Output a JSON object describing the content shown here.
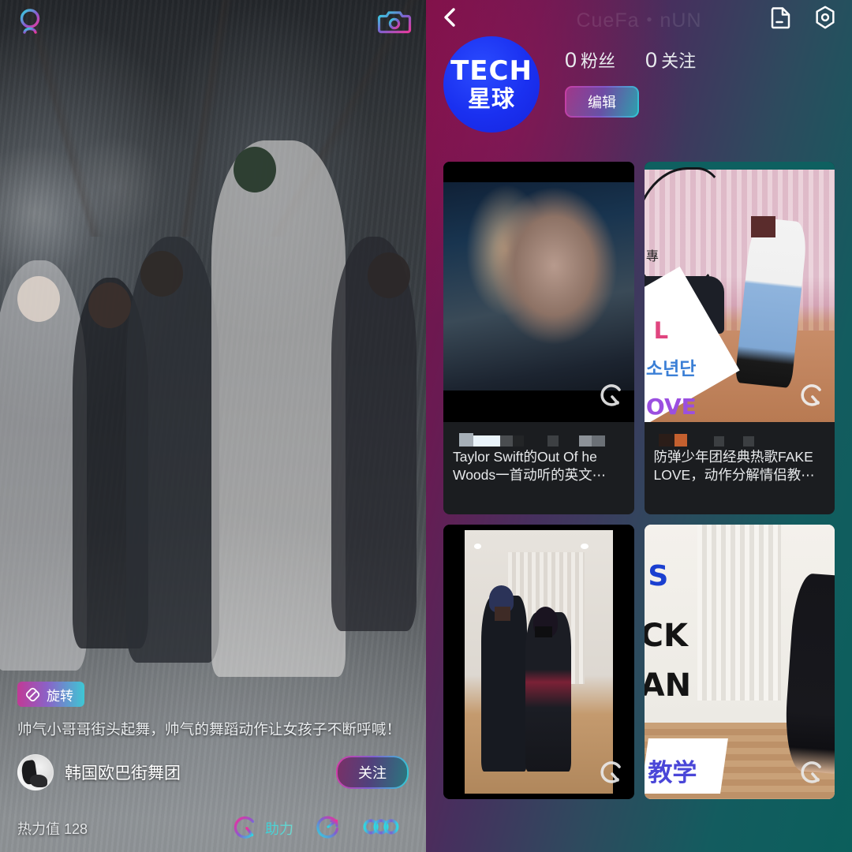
{
  "left_panel": {
    "topbar": {
      "logo_icon": "q-brand-icon",
      "camera_icon": "camera-icon"
    },
    "rotate_chip": {
      "icon": "rotate-icon",
      "label": "旋转"
    },
    "caption": "帅气小哥哥街头起舞，帅气的舞蹈动作让女孩子不断呼喊！",
    "user": {
      "name": "韩国欧巴街舞团",
      "avatar_icon": "user-avatar",
      "follow_label": "关注"
    },
    "heat_label": "热力值",
    "heat_value": "128",
    "actions": [
      {
        "icon": "boost-q-icon",
        "label": "助力"
      },
      {
        "icon": "share-arrow-icon",
        "label": ""
      },
      {
        "icon": "triple-circle-icon",
        "label": ""
      }
    ]
  },
  "right_panel": {
    "topbar": {
      "back_icon": "chevron-left-icon",
      "watermark_title": "CueFa・nUN",
      "file_icon": "file-minus-icon",
      "settings_icon": "hex-gear-icon"
    },
    "profile": {
      "avatar_line1": "TECH",
      "avatar_line2": "星球",
      "stats": [
        {
          "value": "0",
          "label": "粉丝"
        },
        {
          "value": "0",
          "label": "关注"
        }
      ],
      "edit_label": "编辑"
    },
    "videos": [
      {
        "title": "Taylor Swift的Out Of he Woods一首动听的英文⋯",
        "badge_icon": "q-logo-badge",
        "has_mosaic": true,
        "thumb": "taylor-swift-thumb"
      },
      {
        "title": "防弹少年团经典热歌FAKE LOVE，动作分解情侣教⋯",
        "badge_icon": "q-logo-badge",
        "has_mosaic": true,
        "thumb": "bts-fake-love-thumb",
        "overlay_texts": {
          "k1": "L",
          "k2": "소년단",
          "k3": "OVE",
          "k4": "專"
        }
      },
      {
        "title": "",
        "badge_icon": "q-logo-badge",
        "has_mosaic": false,
        "thumb": "couple-dance-thumb"
      },
      {
        "title": "",
        "badge_icon": "q-logo-badge",
        "has_mosaic": false,
        "thumb": "solo-dance-thumb",
        "overlay_texts": {
          "k1": "S",
          "k2": "CK",
          "k3": "AN",
          "k4": "教学"
        }
      }
    ]
  },
  "colors": {
    "accent_pink": "#d63ba4",
    "accent_cyan": "#2fd0d6",
    "accent_purple": "#8257c9",
    "avatar_blue": "#1a30f0",
    "gradient_left": "#7d1047",
    "gradient_right": "#0b5f5c"
  }
}
